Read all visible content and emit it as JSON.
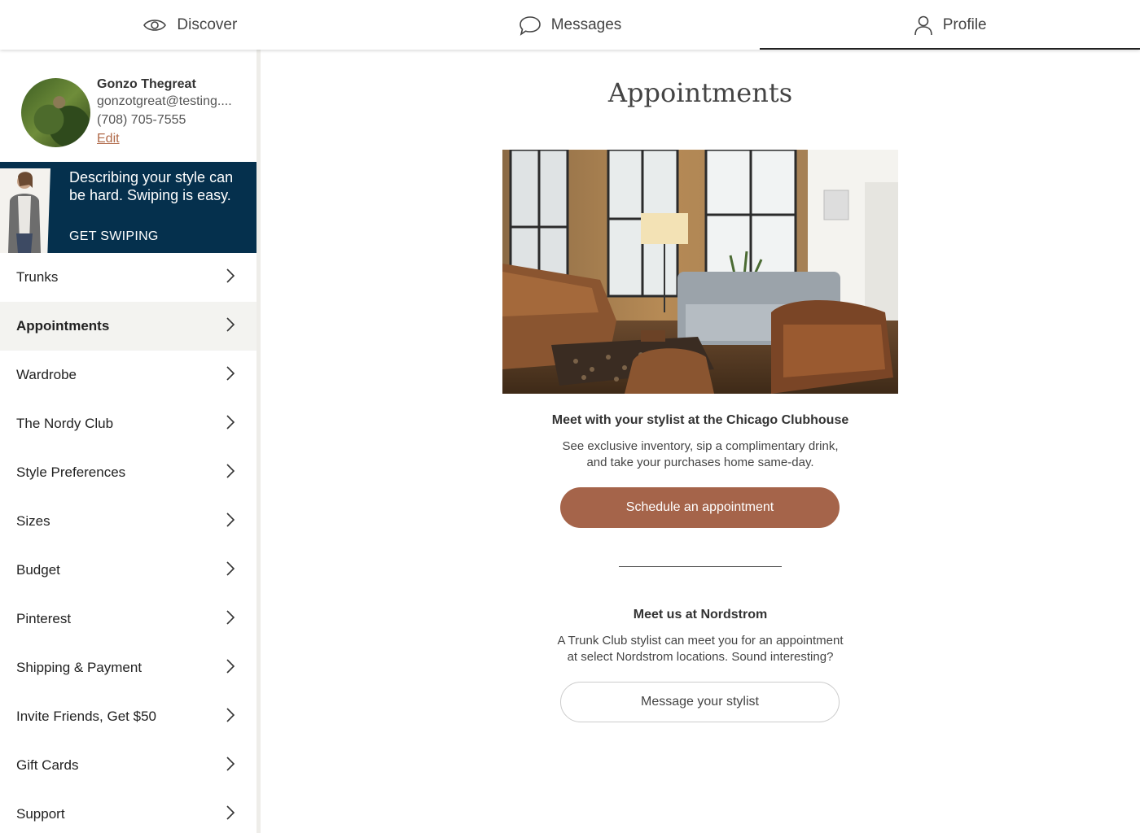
{
  "nav": {
    "tabs": [
      {
        "label": "Discover",
        "icon": "eye-icon"
      },
      {
        "label": "Messages",
        "icon": "chat-bubble-icon"
      },
      {
        "label": "Profile",
        "icon": "person-icon",
        "active": true
      }
    ]
  },
  "profile": {
    "name": "Gonzo Thegreat",
    "email": "gonzotgreat@testing....",
    "phone": "(708) 705-7555",
    "edit_label": "Edit"
  },
  "promo": {
    "text": "Describing your style can be hard. Swiping is easy.",
    "cta": "GET SWIPING",
    "background": "#05304d"
  },
  "sidebar": {
    "items": [
      {
        "label": "Trunks"
      },
      {
        "label": "Appointments",
        "active": true
      },
      {
        "label": "Wardrobe"
      },
      {
        "label": "The Nordy Club"
      },
      {
        "label": "Style Preferences"
      },
      {
        "label": "Sizes"
      },
      {
        "label": "Budget"
      },
      {
        "label": "Pinterest"
      },
      {
        "label": "Shipping & Payment"
      },
      {
        "label": "Invite Friends, Get $50"
      },
      {
        "label": "Gift Cards"
      },
      {
        "label": "Support"
      }
    ]
  },
  "main": {
    "title": "Appointments",
    "clubhouse": {
      "heading": "Meet with your stylist at the Chicago Clubhouse",
      "line1": "See exclusive inventory, sip a complimentary drink,",
      "line2": "and take your purchases home same-day.",
      "button": "Schedule an appointment"
    },
    "nordstrom": {
      "heading": "Meet us at Nordstrom",
      "line1": "A Trunk Club stylist can meet you for an appointment",
      "line2": "at select Nordstrom locations. Sound interesting?",
      "button": "Message your stylist"
    }
  },
  "colors": {
    "accent": "#a5644a",
    "link": "#b06a49",
    "active_row": "#f3f3f0"
  }
}
